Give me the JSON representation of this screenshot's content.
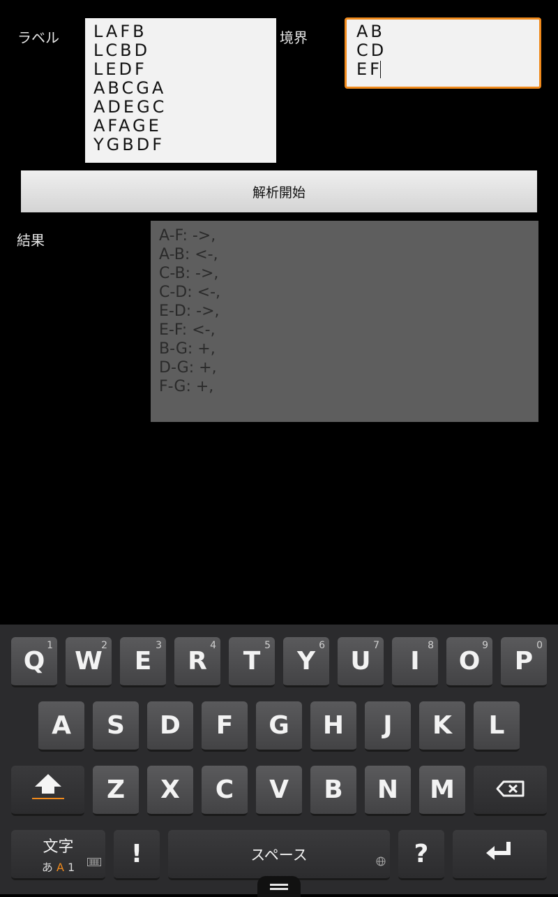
{
  "form": {
    "label_caption": "ラベル",
    "label_lines": [
      "LAFB",
      "LCBD",
      "LEDF",
      "ABCGA",
      "ADEGC",
      "AFAGE",
      "YGBDF"
    ],
    "boundary_caption": "境界",
    "boundary_lines": [
      "AB",
      "CD",
      "EF"
    ],
    "start_button": "解析開始",
    "result_caption": "結果",
    "result_lines": [
      "A-F: ->,",
      "A-B: <-,",
      "C-B: ->,",
      "C-D: <-,",
      "E-D: ->,",
      "E-F: <-,",
      "B-G: +,",
      "D-G: +,",
      "F-G: +,"
    ]
  },
  "keyboard": {
    "row1": [
      {
        "k": "Q",
        "n": "1"
      },
      {
        "k": "W",
        "n": "2"
      },
      {
        "k": "E",
        "n": "3"
      },
      {
        "k": "R",
        "n": "4"
      },
      {
        "k": "T",
        "n": "5"
      },
      {
        "k": "Y",
        "n": "6"
      },
      {
        "k": "U",
        "n": "7"
      },
      {
        "k": "I",
        "n": "8"
      },
      {
        "k": "O",
        "n": "9"
      },
      {
        "k": "P",
        "n": "0"
      }
    ],
    "row2": [
      "A",
      "S",
      "D",
      "F",
      "G",
      "H",
      "J",
      "K",
      "L"
    ],
    "row3": [
      "Z",
      "X",
      "C",
      "V",
      "B",
      "N",
      "M"
    ],
    "mode_big": "文字",
    "mode_small_1": "あ",
    "mode_small_2": "A",
    "mode_small_3": "1",
    "exclaim": "!",
    "space": "スペース",
    "question": "?",
    "icons": [
      "shift-icon",
      "backspace-icon",
      "enter-icon",
      "globe-icon",
      "keyboard-icon",
      "handle-icon"
    ],
    "accent_color": "#f08a1c"
  }
}
